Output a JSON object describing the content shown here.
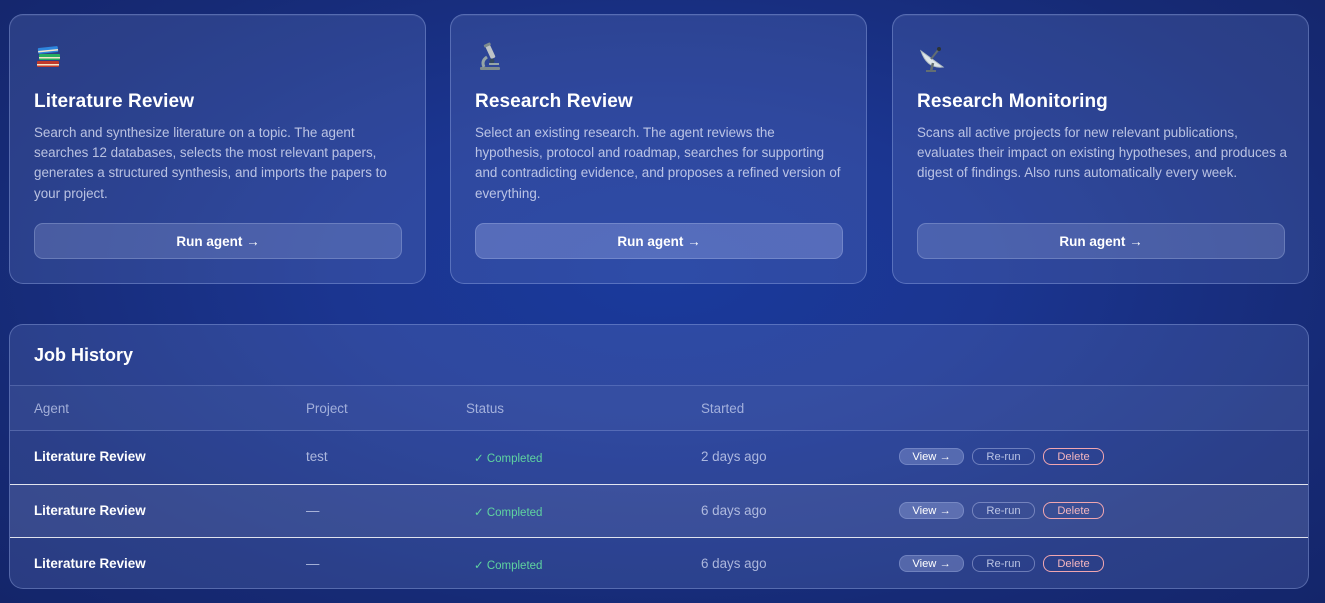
{
  "agents": [
    {
      "icon": "books-icon",
      "title": "Literature Review",
      "description": "Search and synthesize literature on a topic. The agent searches 12 databases, selects the most relevant papers, generates a structured synthesis, and imports the papers to your project.",
      "button_label": "Run agent →"
    },
    {
      "icon": "microscope-icon",
      "title": "Research Review",
      "description": "Select an existing research. The agent reviews the hypothesis, protocol and roadmap, searches for supporting and contradicting evidence, and proposes a refined version of everything.",
      "button_label": "Run agent →"
    },
    {
      "icon": "satellite-dish-icon",
      "title": "Research Monitoring",
      "description": "Scans all active projects for new relevant publications, evaluates their impact on existing hypotheses, and produces a digest of findings. Also runs automatically every week.",
      "button_label": "Run agent →"
    }
  ],
  "job_history": {
    "title": "Job History",
    "columns": [
      "Agent",
      "Project",
      "Status",
      "Started"
    ],
    "rows": [
      {
        "agent": "Literature Review",
        "project": "test",
        "status": "✓ Completed",
        "started": "2 days ago",
        "view": "View →",
        "rerun": "Re-run",
        "delete": "Delete"
      },
      {
        "agent": "Literature Review",
        "project": "—",
        "status": "✓ Completed",
        "started": "6 days ago",
        "view": "View →",
        "rerun": "Re-run",
        "delete": "Delete"
      },
      {
        "agent": "Literature Review",
        "project": "—",
        "status": "✓ Completed",
        "started": "6 days ago",
        "view": "View →",
        "rerun": "Re-run",
        "delete": "Delete"
      }
    ]
  },
  "colors": {
    "status_completed": "#5fd4a0",
    "delete_accent": "#f0a6b0"
  }
}
